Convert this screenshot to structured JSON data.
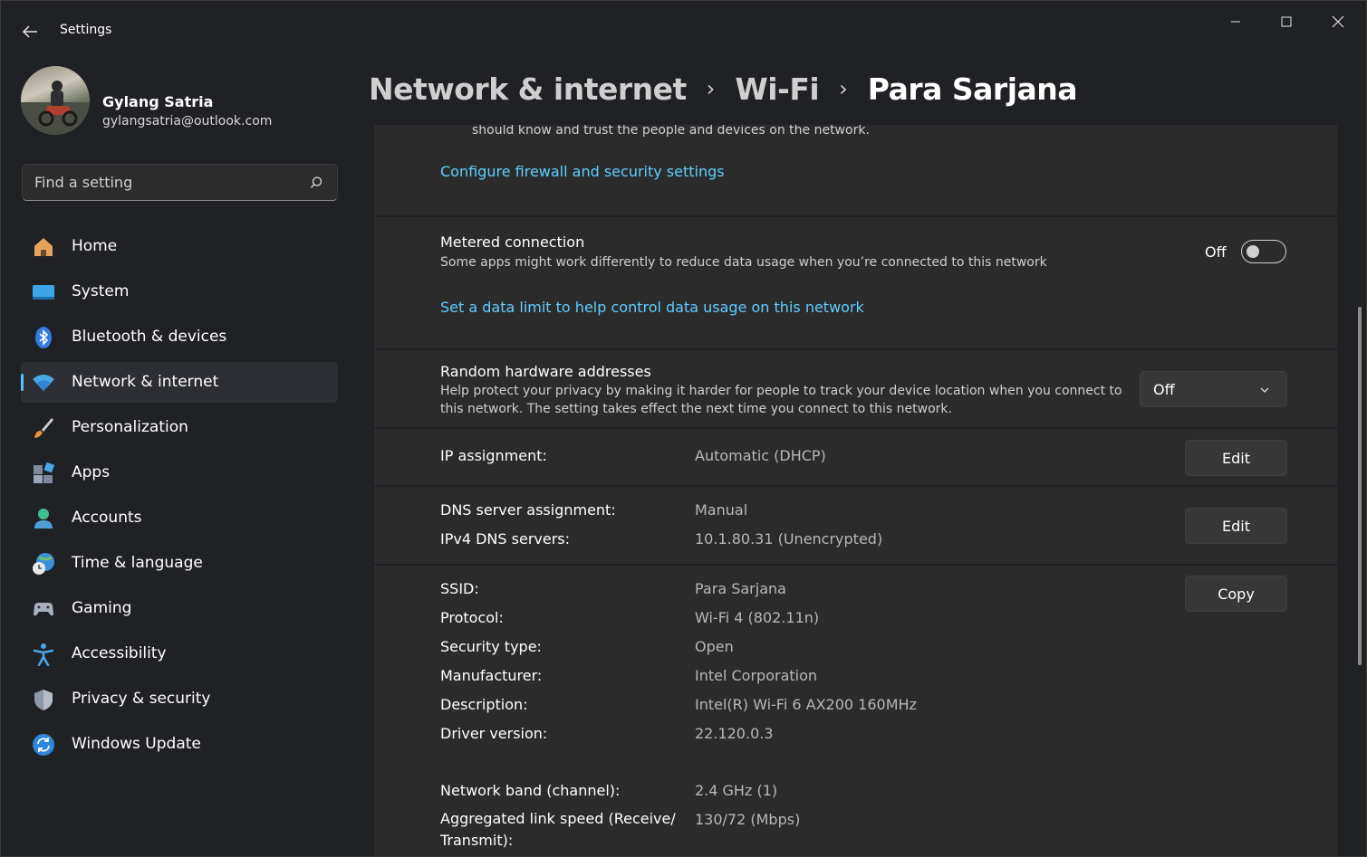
{
  "window": {
    "title": "Settings"
  },
  "profile": {
    "name": "Gylang Satria",
    "email": "gylangsatria@outlook.com"
  },
  "search": {
    "placeholder": "Find a setting"
  },
  "nav": [
    {
      "label": "Home",
      "icon": "home-icon"
    },
    {
      "label": "System",
      "icon": "system-icon"
    },
    {
      "label": "Bluetooth & devices",
      "icon": "bluetooth-icon"
    },
    {
      "label": "Network & internet",
      "icon": "wifi-icon",
      "active": true
    },
    {
      "label": "Personalization",
      "icon": "brush-icon"
    },
    {
      "label": "Apps",
      "icon": "apps-icon"
    },
    {
      "label": "Accounts",
      "icon": "account-icon"
    },
    {
      "label": "Time & language",
      "icon": "globe-clock-icon"
    },
    {
      "label": "Gaming",
      "icon": "gamepad-icon"
    },
    {
      "label": "Accessibility",
      "icon": "accessibility-icon"
    },
    {
      "label": "Privacy & security",
      "icon": "shield-icon"
    },
    {
      "label": "Windows Update",
      "icon": "update-icon"
    }
  ],
  "breadcrumb": [
    "Network & internet",
    "Wi-Fi",
    "Para Sarjana"
  ],
  "firewall": {
    "text": "should know and trust the people and devices on the network.",
    "link": "Configure firewall and security settings"
  },
  "metered": {
    "title": "Metered connection",
    "description": "Some apps might work differently to reduce data usage when you’re connected to this network",
    "state": "Off",
    "link": "Set a data limit to help control data usage on this network"
  },
  "random_hw": {
    "title": "Random hardware addresses",
    "description_1": "Help protect your privacy by making it harder for people to track your device location when you connect to",
    "description_2": "this network. The setting takes effect the next time you connect to this network.",
    "selected": "Off"
  },
  "ip": {
    "label": "IP assignment:",
    "value": "Automatic (DHCP)",
    "button": "Edit"
  },
  "dns": {
    "label": "DNS server assignment:",
    "value": "Manual",
    "ipv4_label": "IPv4 DNS servers:",
    "ipv4_value": "10.1.80.31 (Unencrypted)",
    "button": "Edit"
  },
  "props": {
    "button": "Copy",
    "rows": [
      {
        "label": "SSID:",
        "value": "Para Sarjana"
      },
      {
        "label": "Protocol:",
        "value": "Wi-Fi 4 (802.11n)"
      },
      {
        "label": "Security type:",
        "value": "Open"
      },
      {
        "label": "Manufacturer:",
        "value": "Intel Corporation"
      },
      {
        "label": "Description:",
        "value": "Intel(R) Wi-Fi 6 AX200 160MHz"
      },
      {
        "label": "Driver version:",
        "value": "22.120.0.3"
      }
    ],
    "band_label": "Network band (channel):",
    "band_value": "2.4 GHz (1)",
    "speed_label_1": "Aggregated link speed (Receive/",
    "speed_label_2": "Transmit):",
    "speed_value": "130/72 (Mbps)"
  },
  "colors": {
    "accent": "#4cc2ff",
    "link": "#60cdff",
    "background": "#202124",
    "card": "#2b2b2b"
  }
}
